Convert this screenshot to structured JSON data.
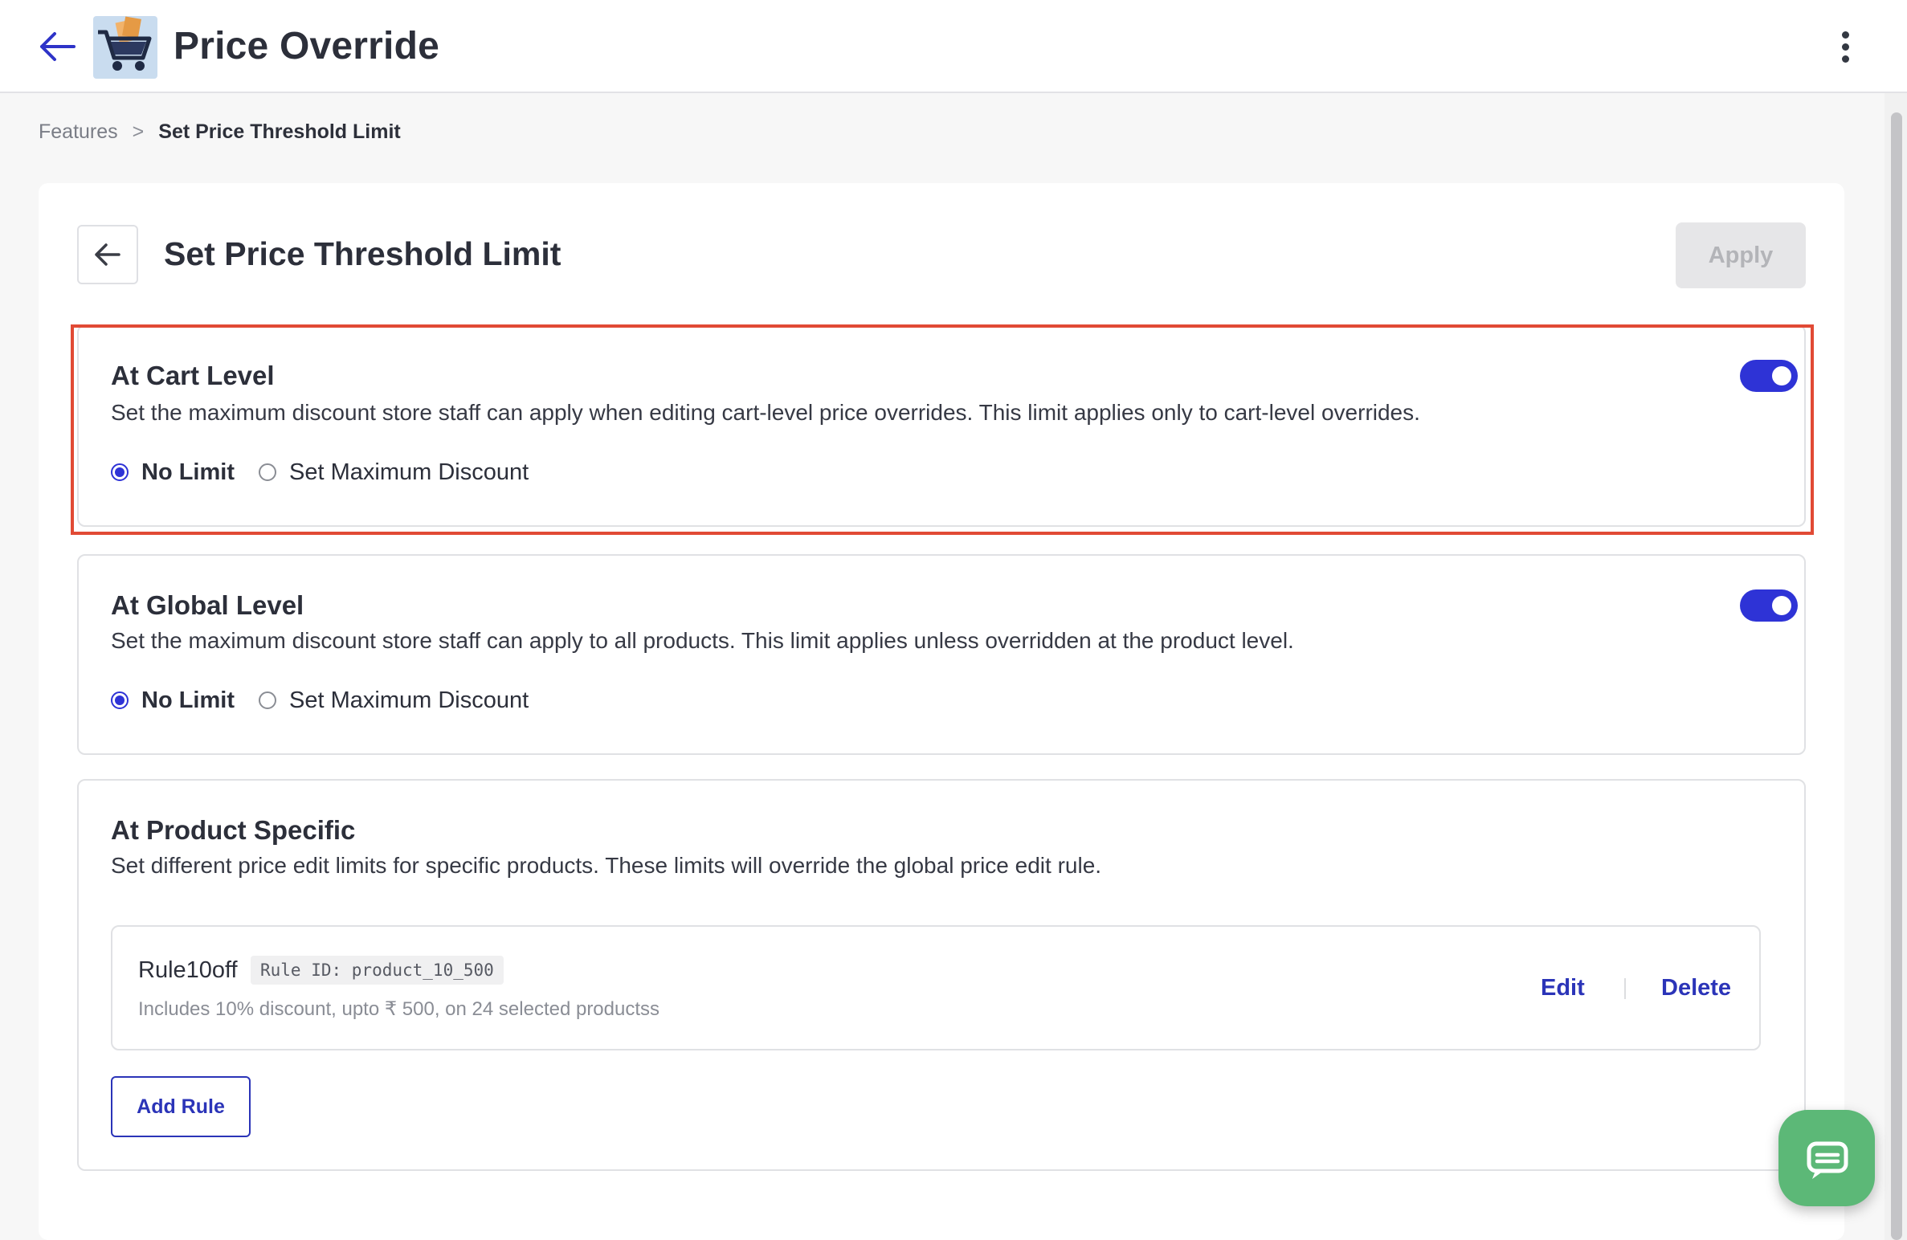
{
  "header": {
    "title": "Price Override",
    "back_icon": "arrow-left-icon",
    "app_icon": "shopping-cart-icon",
    "menu_icon": "more-vertical-icon"
  },
  "breadcrumb": {
    "items": [
      "Features",
      "Set Price Threshold Limit"
    ],
    "separator": ">"
  },
  "page": {
    "title": "Set Price Threshold Limit",
    "apply_label": "Apply"
  },
  "sections": {
    "cart": {
      "title": "At Cart Level",
      "description": "Set the maximum discount store staff can apply when editing cart-level price overrides. This limit applies only to cart-level overrides.",
      "toggle_on": true,
      "options": [
        "No Limit",
        "Set Maximum Discount"
      ],
      "selected": "No Limit"
    },
    "global": {
      "title": "At Global Level",
      "description": "Set the maximum discount store staff can apply to all products. This limit applies unless overridden at the product level.",
      "toggle_on": true,
      "options": [
        "No Limit",
        "Set Maximum Discount"
      ],
      "selected": "No Limit"
    },
    "product": {
      "title": "At Product Specific",
      "description": "Set different price edit limits for specific products. These limits will override the global price edit rule.",
      "rules": [
        {
          "name": "Rule10off",
          "rule_id": "Rule ID: product_10_500",
          "description": "Includes 10% discount, upto ₹ 500, on 24 selected productss",
          "edit_label": "Edit",
          "delete_label": "Delete"
        }
      ],
      "add_rule_label": "Add Rule"
    }
  },
  "colors": {
    "accent": "#2e33d6",
    "link": "#2b34b8",
    "highlight": "#e14a35",
    "chat": "#5cb877"
  },
  "chat_icon": "chat-bubble-icon"
}
